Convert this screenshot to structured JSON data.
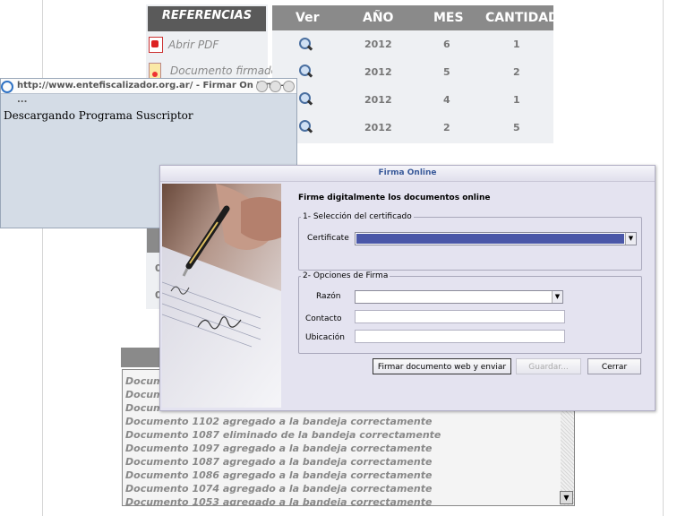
{
  "referencias": {
    "header": "REFERENCIAS",
    "items": [
      {
        "label": "Abrir PDF",
        "icon": "pdf-icon"
      },
      {
        "label": "Documento firmado",
        "icon": "signed-document-icon"
      }
    ]
  },
  "table": {
    "headers": [
      "Ver",
      "AÑO",
      "MES",
      "CANTIDAD"
    ],
    "rows": [
      {
        "year": "2012",
        "month": "6",
        "count": "1"
      },
      {
        "year": "2012",
        "month": "5",
        "count": "2"
      },
      {
        "year": "2012",
        "month": "4",
        "count": "1"
      },
      {
        "year": "2012",
        "month": "2",
        "count": "5"
      }
    ],
    "view_icon": "magnifier-icon"
  },
  "under_dialog": {
    "row1": "0",
    "row2": "0"
  },
  "popup": {
    "title": "http://www.entefiscalizador.org.ar/ - Firmar On Line - ...",
    "message": "Descargando Programa Suscriptor"
  },
  "log": {
    "lines": [
      "Documento",
      "Documento",
      "Documento",
      "Documento 1102 agregado a la bandeja correctamente",
      "Documento 1087 eliminado de la bandeja correctamente",
      "Documento 1097 agregado a la bandeja correctamente",
      "Documento 1087 agregado a la bandeja correctamente",
      "Documento 1086 agregado a la bandeja correctamente",
      "Documento 1074 agregado a la bandeja correctamente",
      "Documento 1053 agregado a la bandeja correctamente"
    ]
  },
  "dialog": {
    "title": "Firma Online",
    "heading": "Firme digitalmente los documentos online",
    "section1": {
      "legend": "1- Selección del certificado",
      "certificate_label": "Certificate"
    },
    "section2": {
      "legend": "2- Opciones de Firma",
      "reason_label": "Razón",
      "contact_label": "Contacto",
      "location_label": "Ubicación"
    },
    "buttons": {
      "sign": "Firmar documento web y enviar",
      "save": "Guardar...",
      "close": "Cerrar"
    },
    "colors": {
      "selected_certificate": "#4a57a8"
    }
  }
}
